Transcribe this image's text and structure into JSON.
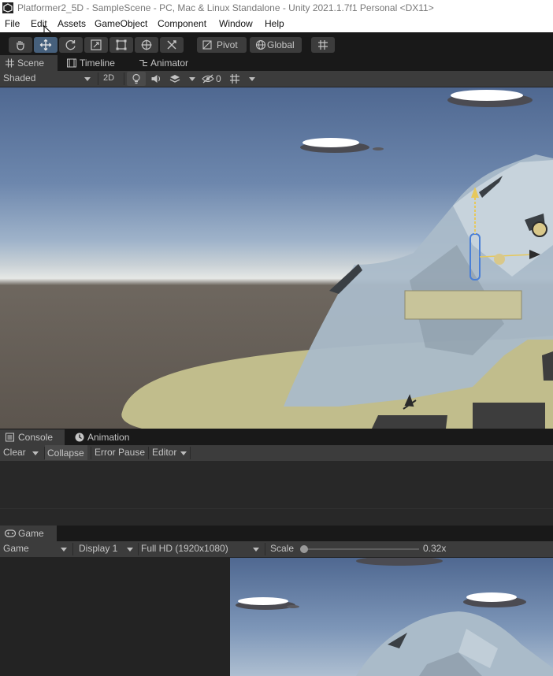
{
  "window": {
    "title": "Platformer2_5D - SampleScene - PC, Mac & Linux Standalone - Unity 2021.1.7f1 Personal <DX11>"
  },
  "menu": [
    "File",
    "Edit",
    "Assets",
    "GameObject",
    "Component",
    "Window",
    "Help"
  ],
  "toolbar": {
    "tools": [
      "hand-tool",
      "move-tool",
      "rotate-tool",
      "scale-tool",
      "rect-tool",
      "transform-tool",
      "custom-tool"
    ],
    "active_tool": "move-tool",
    "pivot_label": "Pivot",
    "global_label": "Global"
  },
  "scene_tabs": {
    "tabs": [
      {
        "label": "Scene",
        "icon": "grid-icon",
        "selected": true
      },
      {
        "label": "Timeline",
        "icon": "film-icon",
        "selected": false
      },
      {
        "label": "Animator",
        "icon": "animator-icon",
        "selected": false
      }
    ]
  },
  "scene_controls": {
    "draw_mode": "Shaded",
    "mode_2d": "2D",
    "hidden_count": "0"
  },
  "console_tabs": {
    "tabs": [
      {
        "label": "Console",
        "icon": "console-icon",
        "selected": true
      },
      {
        "label": "Animation",
        "icon": "clock-icon",
        "selected": false
      }
    ]
  },
  "console_controls": {
    "clear": "Clear",
    "collapse": "Collapse",
    "error_pause": "Error Pause",
    "editor": "Editor"
  },
  "game_tabs": {
    "tabs": [
      {
        "label": "Game",
        "icon": "gamepad-icon",
        "selected": true
      }
    ]
  },
  "game_controls": {
    "game_dropdown": "Game",
    "display": "Display 1",
    "resolution": "Full HD (1920x1080)",
    "scale_label": "Scale",
    "scale_value": "0.32x",
    "scale_fraction": 0.0
  },
  "colors": {
    "editor_bg": "#191919",
    "panel_bg": "#3c3c3c",
    "active_tool": "#46607c",
    "sky_top": "#4f6891",
    "mountain": "#a9bccd",
    "ground_plane": "#c1bd8c"
  }
}
